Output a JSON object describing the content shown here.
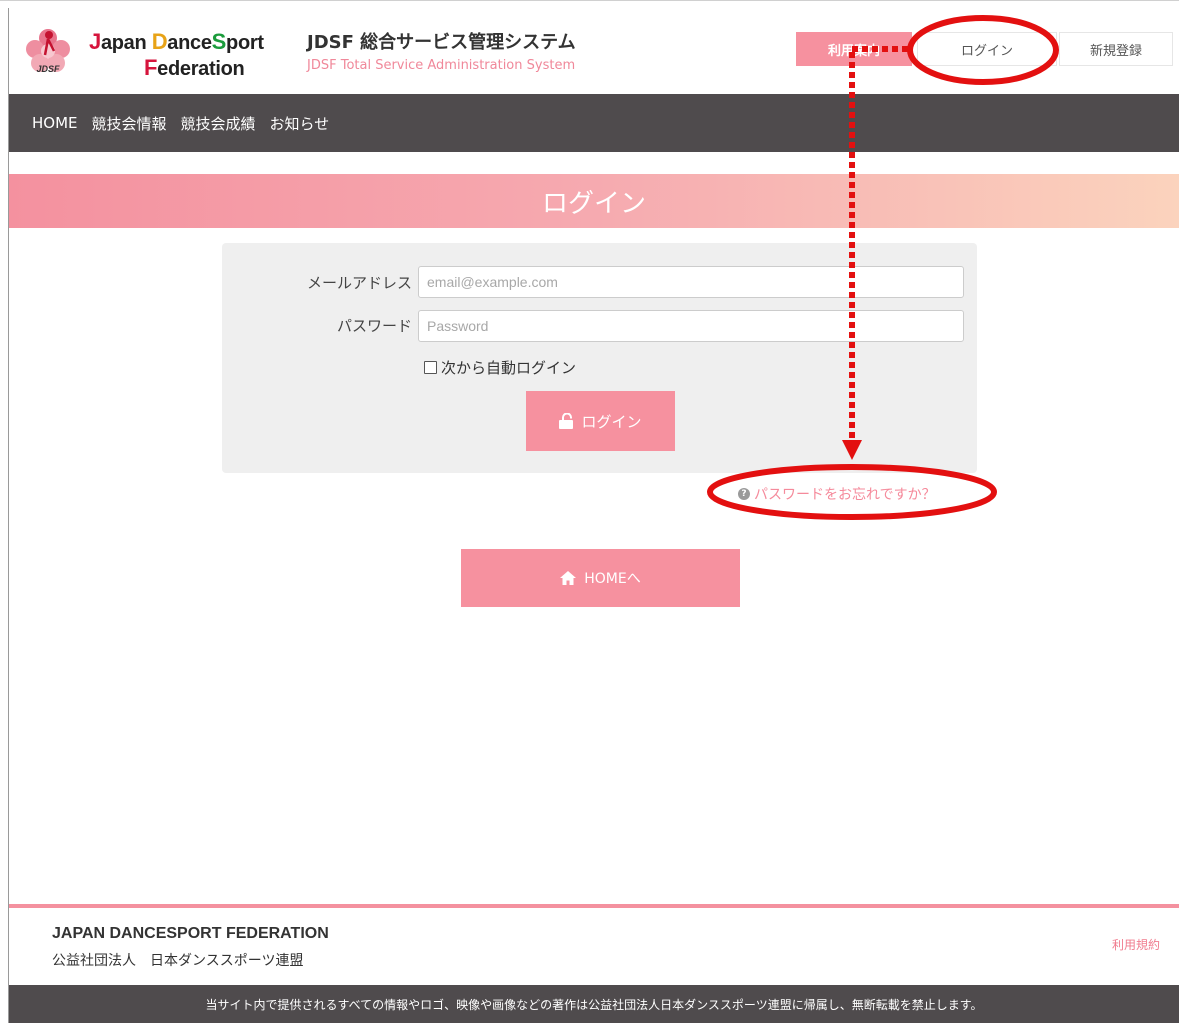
{
  "header": {
    "brand_line1": "Japan DanceSport",
    "brand_line1_parts": [
      "J",
      "apan ",
      "D",
      "ance",
      "S",
      "port"
    ],
    "brand_line2_parts": [
      "F",
      "ederation"
    ],
    "logo_text": "JDSF",
    "system_title": "JDSF 総合サービス管理システム",
    "system_subtitle": "JDSF Total Service Administration System",
    "guide_label": "利用案内",
    "login_label": "ログイン",
    "register_label": "新規登録"
  },
  "nav": {
    "items": [
      {
        "label": "HOME"
      },
      {
        "label": "競技会情報"
      },
      {
        "label": "競技会成績"
      },
      {
        "label": "お知らせ"
      }
    ]
  },
  "banner": {
    "title": "ログイン"
  },
  "form": {
    "email_label": "メールアドレス",
    "email_placeholder": "email@example.com",
    "email_value": "",
    "password_label": "パスワード",
    "password_placeholder": "Password",
    "password_value": "",
    "remember_label": "次から自動ログイン",
    "remember_checked": false,
    "login_button_label": "ログイン",
    "lock_icon": "unlock-icon"
  },
  "forgot": {
    "label": "パスワードをお忘れですか？",
    "icon": "question-circle-icon"
  },
  "home_button": {
    "label": "HOMEへ",
    "icon": "home-icon"
  },
  "footer": {
    "org_name": "JAPAN DANCESPORT FEDERATION",
    "org_jp": "公益社団法人　日本ダンススポーツ連盟",
    "terms_label": "利用規約",
    "copyright": "当サイト内で提供されるすべての情報やロゴ、映像や画像などの著作は公益社団法人日本ダンススポーツ連盟に帰属し、無断転載を禁止します。"
  },
  "colors": {
    "accent_pink": "#f6919f",
    "nav_bg": "#4f4b4d",
    "annotation_red": "#e31010"
  }
}
